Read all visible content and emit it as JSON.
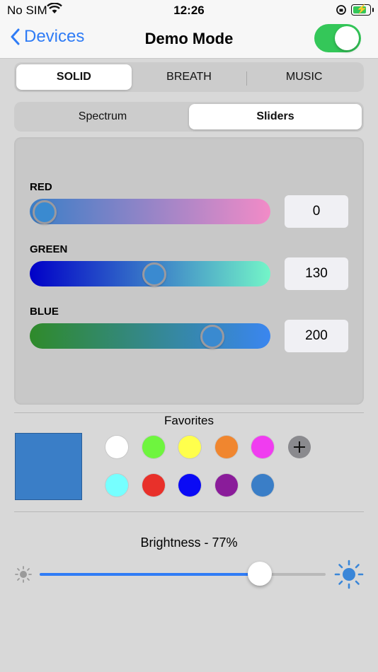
{
  "status": {
    "carrier": "No SIM",
    "time": "12:26"
  },
  "nav": {
    "back_label": "Devices",
    "title": "Demo Mode",
    "toggle_on": true
  },
  "mode_tabs": [
    {
      "label": "SOLID",
      "active": true
    },
    {
      "label": "BREATH",
      "active": false
    },
    {
      "label": "MUSIC",
      "active": false
    }
  ],
  "picker_tabs": [
    {
      "label": "Spectrum",
      "active": false
    },
    {
      "label": "Sliders",
      "active": true
    }
  ],
  "sliders": {
    "red": {
      "label": "RED",
      "value": "0",
      "fraction": 0
    },
    "green": {
      "label": "GREEN",
      "value": "130",
      "fraction": 0.51
    },
    "blue": {
      "label": "BLUE",
      "value": "200",
      "fraction": 0.78
    }
  },
  "favorites": {
    "title": "Favorites",
    "current_color": "#3a7ec7",
    "colors": [
      "#ffffff",
      "#6ef53e",
      "#ffff4c",
      "#f0862f",
      "#f03cf0",
      "#76ffff",
      "#e8302a",
      "#0a0af5",
      "#8a1c9a",
      "#3a7ec7"
    ]
  },
  "brightness": {
    "label": "Brightness - 77%",
    "fraction": 0.77
  }
}
